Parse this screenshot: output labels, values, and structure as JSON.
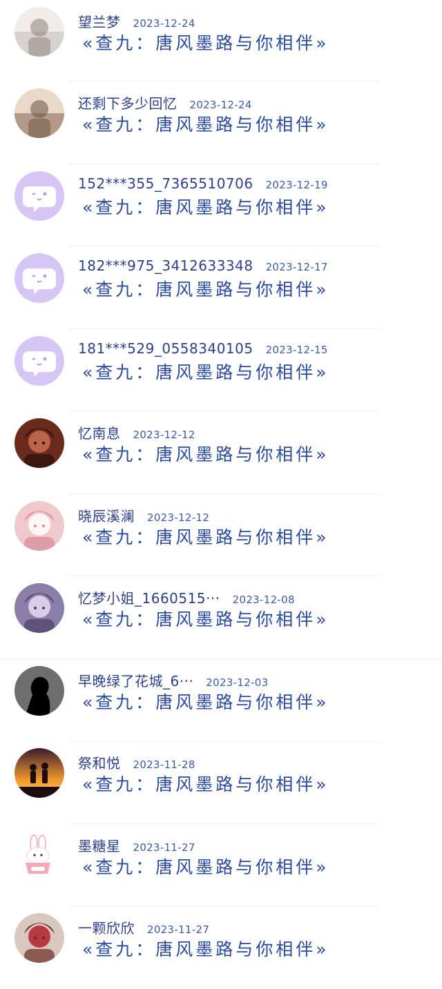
{
  "comments": [
    {
      "name": "望兰梦",
      "date": "2023-12-24",
      "message": "«查九：唐风墨路与你相伴»",
      "avatar_icon": "user-photo-avatar-icon",
      "colors": [
        "#d8d2cf",
        "#f2ece8",
        "#8c7f7c"
      ]
    },
    {
      "name": "还剩下多少回忆",
      "date": "2023-12-24",
      "message": "«查九：唐风墨路与你相伴»",
      "avatar_icon": "user-photo-avatar-icon",
      "colors": [
        "#b29a86",
        "#e9d9c8",
        "#6b5040"
      ]
    },
    {
      "name": "152***355_7365510706",
      "date": "2023-12-19",
      "message": "«查九：唐风墨路与你相伴»",
      "avatar_icon": "default-chat-avatar-icon",
      "colors": [
        "#d6c6f6",
        "#ffffff",
        "#b29ce8"
      ]
    },
    {
      "name": "182***975_3412633348",
      "date": "2023-12-17",
      "message": "«查九：唐风墨路与你相伴»",
      "avatar_icon": "default-chat-avatar-icon",
      "colors": [
        "#d6c6f6",
        "#ffffff",
        "#b29ce8"
      ]
    },
    {
      "name": "181***529_0558340105",
      "date": "2023-12-15",
      "message": "«查九：唐风墨路与你相伴»",
      "avatar_icon": "default-chat-avatar-icon",
      "colors": [
        "#d6c6f6",
        "#ffffff",
        "#b29ce8"
      ]
    },
    {
      "name": "忆南息",
      "date": "2023-12-12",
      "message": "«查九：唐风墨路与你相伴»",
      "avatar_icon": "anime-avatar-icon",
      "colors": [
        "#6a2a1c",
        "#c97050",
        "#2a0f0a"
      ]
    },
    {
      "name": "晓辰溪澜",
      "date": "2023-12-12",
      "message": "«查九：唐风墨路与你相伴»",
      "avatar_icon": "anime-avatar-icon",
      "colors": [
        "#f1c8cc",
        "#ffffff",
        "#d58a94"
      ]
    },
    {
      "name": "忆梦小姐_1660515···",
      "date": "2023-12-08",
      "message": "«查九：唐风墨路与你相伴»",
      "avatar_icon": "anime-avatar-icon",
      "colors": [
        "#8b7ea8",
        "#e5dcf2",
        "#4b3f66"
      ]
    },
    {
      "name": "早晚绿了花城_6···",
      "date": "2023-12-03",
      "message": "«查九：唐风墨路与你相伴»",
      "avatar_icon": "silhouette-avatar-icon",
      "colors": [
        "#1a1a1a",
        "#6e6e6e",
        "#000000"
      ]
    },
    {
      "name": "祭和悦",
      "date": "2023-11-28",
      "message": "«查九：唐风墨路与你相伴»",
      "avatar_icon": "sunset-couple-avatar-icon",
      "colors": [
        "#f29a2e",
        "#3d1d2c",
        "#ffd470"
      ]
    },
    {
      "name": "墨糖星",
      "date": "2023-11-27",
      "message": "«查九：唐风墨路与你相伴»",
      "avatar_icon": "bunny-avatar-icon",
      "colors": [
        "#ffffff",
        "#f4a9b8",
        "#e16a7e"
      ]
    },
    {
      "name": "一颗欣欣",
      "date": "2023-11-27",
      "message": "«查九：唐风墨路与你相伴»",
      "avatar_icon": "anime-avatar-icon",
      "colors": [
        "#d8c8c0",
        "#b3212a",
        "#6b2a20"
      ]
    }
  ]
}
